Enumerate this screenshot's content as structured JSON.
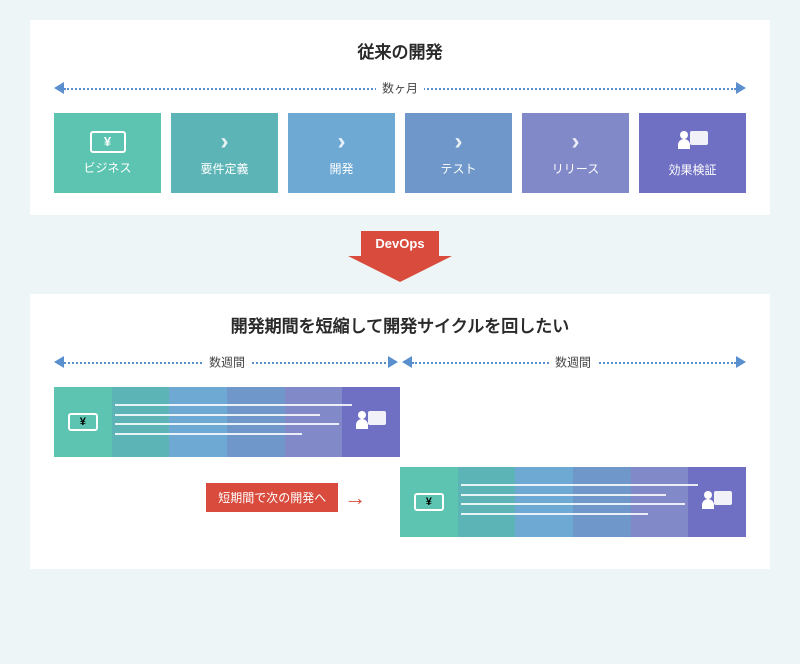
{
  "top": {
    "title": "従来の開発",
    "timeline_label": "数ヶ月",
    "stages": [
      {
        "label": "ビジネス",
        "icon": "yen"
      },
      {
        "label": "要件定義",
        "icon": "chevron"
      },
      {
        "label": "開発",
        "icon": "chevron"
      },
      {
        "label": "テスト",
        "icon": "chevron"
      },
      {
        "label": "リリース",
        "icon": "chevron"
      },
      {
        "label": "効果検証",
        "icon": "person-chart"
      }
    ]
  },
  "devops_label": "DevOps",
  "bottom": {
    "title": "開発期間を短縮して開発サイクルを回したい",
    "cycle_label_a": "数週間",
    "cycle_label_b": "数週間",
    "transition_label": "短期間で次の開発へ",
    "yen_symbol": "¥"
  },
  "colors": {
    "stage": [
      "#5cc4b0",
      "#5db4b6",
      "#6ea9d4",
      "#7097c9",
      "#8189c8",
      "#6f6fc4"
    ],
    "accent": "#d94b3c",
    "arrow": "#5a8fcf"
  }
}
